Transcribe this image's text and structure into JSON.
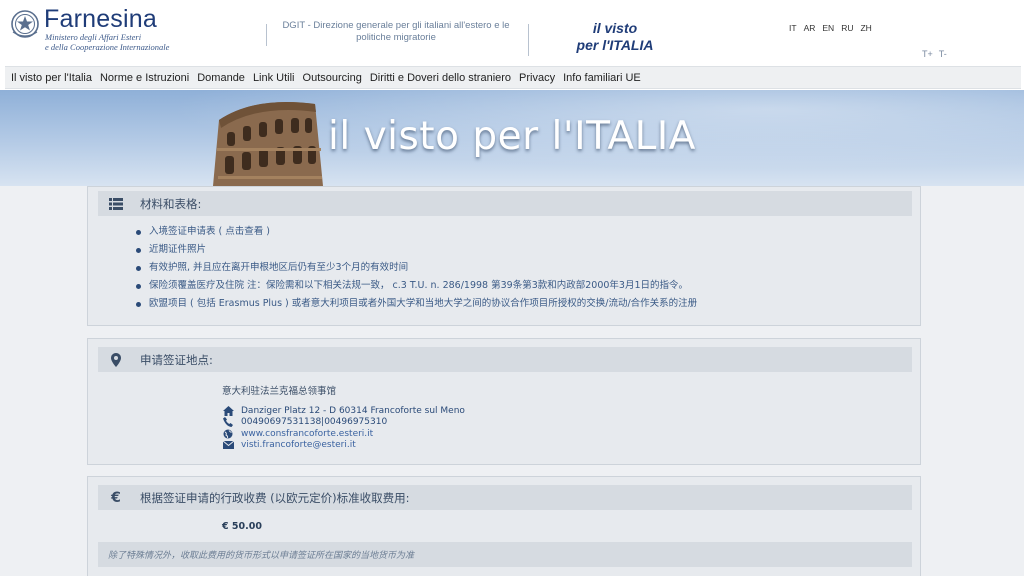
{
  "logo": {
    "brand": "Farnesina",
    "subtitle_line1": "Ministero degli Affari Esteri",
    "subtitle_line2": "e della Cooperazione Internazionale"
  },
  "header": {
    "dgit_line1": "DGIT - Direzione generale per gli italiani all'estero e le",
    "dgit_line2": "politiche migratorie",
    "visto_line1": "il visto",
    "visto_line2": "per l'ITALIA",
    "languages": [
      "IT",
      "AR",
      "EN",
      "RU",
      "ZH"
    ],
    "text_increase": "T+",
    "text_decrease": "T-"
  },
  "nav": {
    "items": [
      "Il visto per l'Italia",
      "Norme e Istruzioni",
      "Domande",
      "Link Utili",
      "Outsourcing",
      "Diritti e Doveri dello straniero",
      "Privacy",
      "Info familiari UE"
    ]
  },
  "banner": {
    "title": "il visto per l'ITALIA"
  },
  "materials": {
    "heading": "材料和表格:",
    "items": [
      "入境签证申请表 ( 点击查看 )",
      "近期证件照片",
      "有效护照, 并且应在离开申根地区后仍有至少3个月的有效时间",
      "保险须覆盖医疗及住院 注：保险需和以下相关法规一致， c.3 T.U. n. 286/1998 第39条第3款和内政部2000年3月1日的指令。",
      "欧盟项目 ( 包括 Erasmus Plus ) 或者意大利项目或者外国大学和当地大学之间的协议合作项目所授权的交换/流动/合作关系的注册"
    ]
  },
  "location": {
    "heading": "申请签证地点:",
    "office": "意大利驻法兰克福总领事馆",
    "address": "Danziger Platz 12 - D 60314 Francoforte sul Meno",
    "phone": "00490697531138|00496975310",
    "website": "www.consfrancoforte.esteri.it",
    "email": "visti.francoforte@esteri.it"
  },
  "fees": {
    "heading": "根据签证申请的行政收费 (以欧元定价)标准收取费用:",
    "amount": "€ 50.00",
    "note": "除了特殊情况外，收取此费用的货币形式以申请签证所在国家的当地货币为准"
  },
  "colors": {
    "brand_blue": "#1f3c78",
    "link_blue": "#3a62a0",
    "card_bg": "#e7eaee",
    "card_head_bg": "#d6dbe1"
  }
}
